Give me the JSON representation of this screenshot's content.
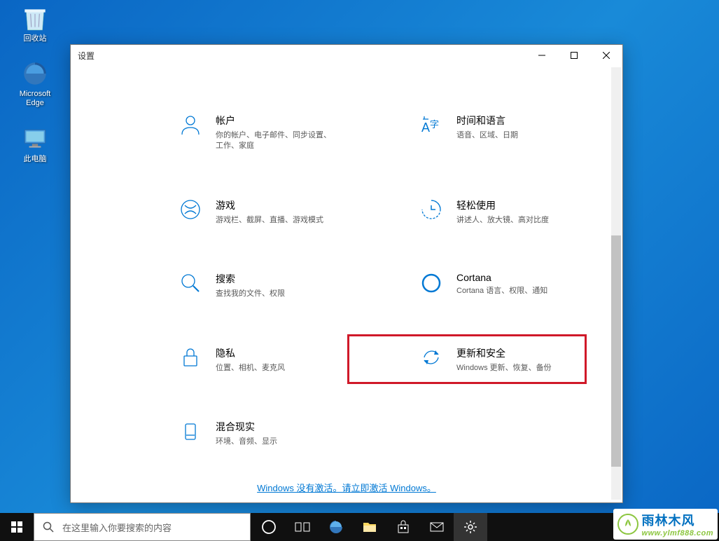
{
  "desktop": {
    "icons": [
      {
        "label": "回收站"
      },
      {
        "label": "Microsoft Edge"
      },
      {
        "label": "此电脑"
      }
    ]
  },
  "window": {
    "title": "设置"
  },
  "settings": {
    "items": [
      {
        "title": "帐户",
        "desc": "你的帐户、电子邮件、同步设置、工作、家庭"
      },
      {
        "title": "时间和语言",
        "desc": "语音、区域、日期"
      },
      {
        "title": "游戏",
        "desc": "游戏栏、截屏、直播、游戏模式"
      },
      {
        "title": "轻松使用",
        "desc": "讲述人、放大镜、高对比度"
      },
      {
        "title": "搜索",
        "desc": "查找我的文件、权限"
      },
      {
        "title": "Cortana",
        "desc": "Cortana 语言、权限、通知"
      },
      {
        "title": "隐私",
        "desc": "位置、相机、麦克风"
      },
      {
        "title": "更新和安全",
        "desc": "Windows 更新、恢复、备份"
      },
      {
        "title": "混合现实",
        "desc": "环境、音频、显示"
      }
    ],
    "activate_link": "Windows 没有激活。请立即激活 Windows。"
  },
  "taskbar": {
    "search_placeholder": "在这里输入你要搜索的内容"
  },
  "watermark": {
    "title": "雨林木风",
    "url": "www.ylmf888.com"
  }
}
